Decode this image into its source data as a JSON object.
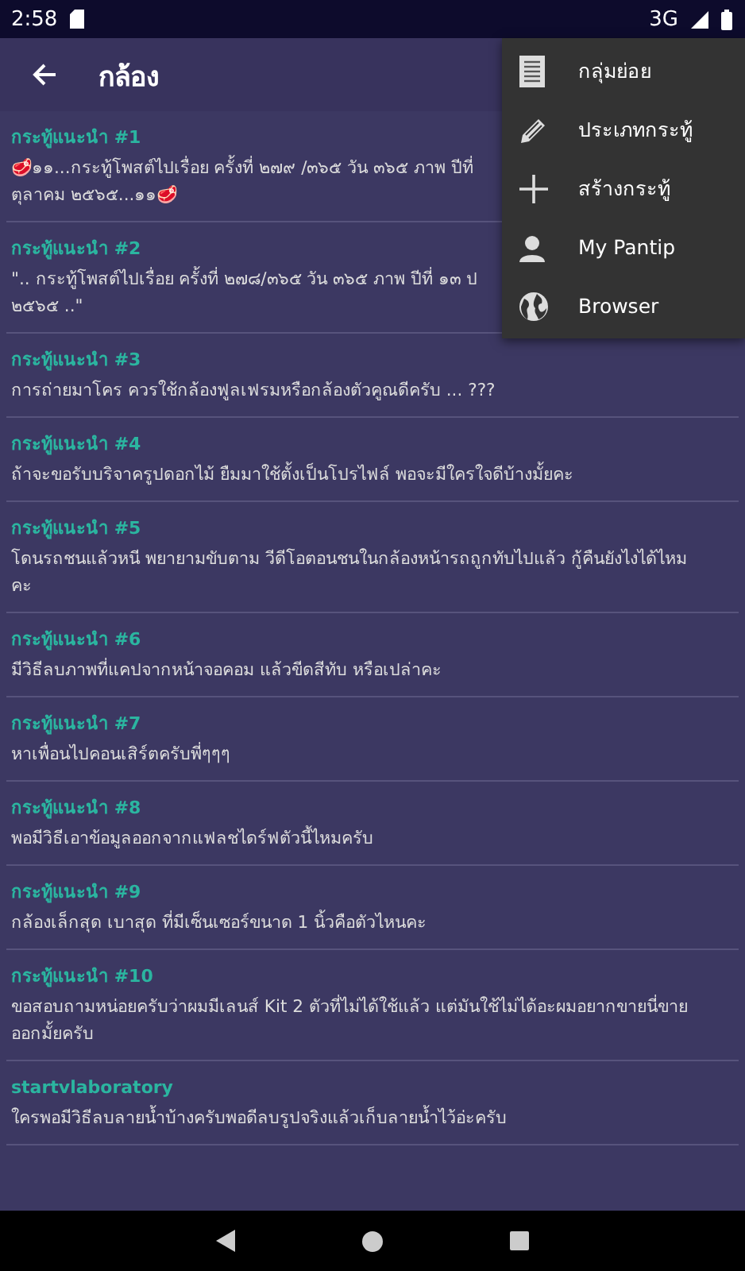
{
  "status_bar": {
    "time": "2:58",
    "network": "3G"
  },
  "app_bar": {
    "title": "กล้อง"
  },
  "posts": [
    {
      "title": "กระทู้แนะนำ #1",
      "lines": [
        "🥩๑๑...กระทู้โพสต์ไปเรื่อย ครั้งที่ ๒๗๙ /๓๖๕ วัน ๓๖๕ ภาพ ปีที่",
        "ตุลาคม ๒๕๖๕...๑๑🥩"
      ]
    },
    {
      "title": "กระทู้แนะนำ #2",
      "lines": [
        "\".. กระทู้โพสต์ไปเรื่อย ครั้งที่ ๒๗๘/๓๖๕ วัน ๓๖๕ ภาพ ปีที่ ๑๓ ป",
        "๒๕๖๕ ..\""
      ]
    },
    {
      "title": "กระทู้แนะนำ #3",
      "lines": [
        "การถ่ายมาโคร ควรใช้กล้องฟูลเฟรมหรือกล้องตัวคูณดีครับ ... ???"
      ]
    },
    {
      "title": "กระทู้แนะนำ #4",
      "lines": [
        "ถ้าจะขอรับบริจาครูปดอกไม้ ยืมมาใช้ตั้งเป็นโปรไฟล์ พอจะมีใครใจดีบ้างมั้ยคะ"
      ]
    },
    {
      "title": "กระทู้แนะนำ #5",
      "lines": [
        "โดนรถชนแล้วหนี พยายามขับตาม วีดีโอตอนชนในกล้องหน้ารถถูกทับไปแล้ว กู้คืนยังไงได้ไหม",
        "คะ"
      ]
    },
    {
      "title": "กระทู้แนะนำ #6",
      "lines": [
        "มีวิธีลบภาพที่แคปจากหน้าจอคอม แล้วขีดสีทับ หรือเปล่าคะ"
      ]
    },
    {
      "title": "กระทู้แนะนำ #7",
      "lines": [
        "หาเพื่อนไปคอนเสิร์ตครับพี่ๆๆๆ"
      ]
    },
    {
      "title": "กระทู้แนะนำ #8",
      "lines": [
        "พอมีวิธีเอาข้อมูลออกจากแฟลชไดร์ฟตัวนี้ไหมครับ"
      ]
    },
    {
      "title": "กระทู้แนะนำ #9",
      "lines": [
        "กล้องเล็กสุด เบาสุด ที่มีเซ็นเซอร์ขนาด 1 นิ้วคือตัวไหนคะ"
      ]
    },
    {
      "title": "กระทู้แนะนำ #10",
      "lines": [
        "ขอสอบถามหน่อยครับว่าผมมีเลนส์ Kit 2 ตัวที่ไม่ได้ใช้แล้ว แต่มันใช้ไม่ได้อะผมอยากขายนี่ขาย",
        "ออกมั้ยครับ"
      ]
    },
    {
      "title": "startvlaboratory",
      "lines": [
        "ใครพอมีวิธีลบลายน้ำบ้างครับพอดีลบรูปจริงแล้วเก็บลายน้ำไว้อ่ะครับ"
      ]
    }
  ],
  "menu": [
    {
      "kind": "list",
      "label": "กลุ่มย่อย"
    },
    {
      "kind": "pencil",
      "label": "ประเภทกระทู้"
    },
    {
      "kind": "plus",
      "label": "สร้างกระทู้"
    },
    {
      "kind": "person",
      "label": "My Pantip"
    },
    {
      "kind": "globe",
      "label": "Browser"
    }
  ]
}
